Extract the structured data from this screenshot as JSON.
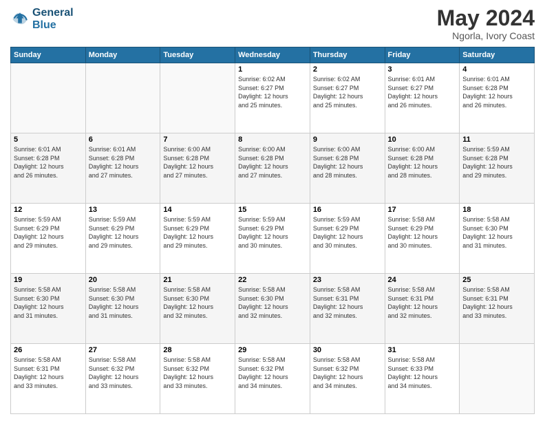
{
  "header": {
    "logo_line1": "General",
    "logo_line2": "Blue",
    "month_year": "May 2024",
    "location": "Ngorla, Ivory Coast"
  },
  "weekdays": [
    "Sunday",
    "Monday",
    "Tuesday",
    "Wednesday",
    "Thursday",
    "Friday",
    "Saturday"
  ],
  "weeks": [
    [
      {
        "day": "",
        "info": ""
      },
      {
        "day": "",
        "info": ""
      },
      {
        "day": "",
        "info": ""
      },
      {
        "day": "1",
        "info": "Sunrise: 6:02 AM\nSunset: 6:27 PM\nDaylight: 12 hours\nand 25 minutes."
      },
      {
        "day": "2",
        "info": "Sunrise: 6:02 AM\nSunset: 6:27 PM\nDaylight: 12 hours\nand 25 minutes."
      },
      {
        "day": "3",
        "info": "Sunrise: 6:01 AM\nSunset: 6:27 PM\nDaylight: 12 hours\nand 26 minutes."
      },
      {
        "day": "4",
        "info": "Sunrise: 6:01 AM\nSunset: 6:28 PM\nDaylight: 12 hours\nand 26 minutes."
      }
    ],
    [
      {
        "day": "5",
        "info": "Sunrise: 6:01 AM\nSunset: 6:28 PM\nDaylight: 12 hours\nand 26 minutes."
      },
      {
        "day": "6",
        "info": "Sunrise: 6:01 AM\nSunset: 6:28 PM\nDaylight: 12 hours\nand 27 minutes."
      },
      {
        "day": "7",
        "info": "Sunrise: 6:00 AM\nSunset: 6:28 PM\nDaylight: 12 hours\nand 27 minutes."
      },
      {
        "day": "8",
        "info": "Sunrise: 6:00 AM\nSunset: 6:28 PM\nDaylight: 12 hours\nand 27 minutes."
      },
      {
        "day": "9",
        "info": "Sunrise: 6:00 AM\nSunset: 6:28 PM\nDaylight: 12 hours\nand 28 minutes."
      },
      {
        "day": "10",
        "info": "Sunrise: 6:00 AM\nSunset: 6:28 PM\nDaylight: 12 hours\nand 28 minutes."
      },
      {
        "day": "11",
        "info": "Sunrise: 5:59 AM\nSunset: 6:28 PM\nDaylight: 12 hours\nand 29 minutes."
      }
    ],
    [
      {
        "day": "12",
        "info": "Sunrise: 5:59 AM\nSunset: 6:29 PM\nDaylight: 12 hours\nand 29 minutes."
      },
      {
        "day": "13",
        "info": "Sunrise: 5:59 AM\nSunset: 6:29 PM\nDaylight: 12 hours\nand 29 minutes."
      },
      {
        "day": "14",
        "info": "Sunrise: 5:59 AM\nSunset: 6:29 PM\nDaylight: 12 hours\nand 29 minutes."
      },
      {
        "day": "15",
        "info": "Sunrise: 5:59 AM\nSunset: 6:29 PM\nDaylight: 12 hours\nand 30 minutes."
      },
      {
        "day": "16",
        "info": "Sunrise: 5:59 AM\nSunset: 6:29 PM\nDaylight: 12 hours\nand 30 minutes."
      },
      {
        "day": "17",
        "info": "Sunrise: 5:58 AM\nSunset: 6:29 PM\nDaylight: 12 hours\nand 30 minutes."
      },
      {
        "day": "18",
        "info": "Sunrise: 5:58 AM\nSunset: 6:30 PM\nDaylight: 12 hours\nand 31 minutes."
      }
    ],
    [
      {
        "day": "19",
        "info": "Sunrise: 5:58 AM\nSunset: 6:30 PM\nDaylight: 12 hours\nand 31 minutes."
      },
      {
        "day": "20",
        "info": "Sunrise: 5:58 AM\nSunset: 6:30 PM\nDaylight: 12 hours\nand 31 minutes."
      },
      {
        "day": "21",
        "info": "Sunrise: 5:58 AM\nSunset: 6:30 PM\nDaylight: 12 hours\nand 32 minutes."
      },
      {
        "day": "22",
        "info": "Sunrise: 5:58 AM\nSunset: 6:30 PM\nDaylight: 12 hours\nand 32 minutes."
      },
      {
        "day": "23",
        "info": "Sunrise: 5:58 AM\nSunset: 6:31 PM\nDaylight: 12 hours\nand 32 minutes."
      },
      {
        "day": "24",
        "info": "Sunrise: 5:58 AM\nSunset: 6:31 PM\nDaylight: 12 hours\nand 32 minutes."
      },
      {
        "day": "25",
        "info": "Sunrise: 5:58 AM\nSunset: 6:31 PM\nDaylight: 12 hours\nand 33 minutes."
      }
    ],
    [
      {
        "day": "26",
        "info": "Sunrise: 5:58 AM\nSunset: 6:31 PM\nDaylight: 12 hours\nand 33 minutes."
      },
      {
        "day": "27",
        "info": "Sunrise: 5:58 AM\nSunset: 6:32 PM\nDaylight: 12 hours\nand 33 minutes."
      },
      {
        "day": "28",
        "info": "Sunrise: 5:58 AM\nSunset: 6:32 PM\nDaylight: 12 hours\nand 33 minutes."
      },
      {
        "day": "29",
        "info": "Sunrise: 5:58 AM\nSunset: 6:32 PM\nDaylight: 12 hours\nand 34 minutes."
      },
      {
        "day": "30",
        "info": "Sunrise: 5:58 AM\nSunset: 6:32 PM\nDaylight: 12 hours\nand 34 minutes."
      },
      {
        "day": "31",
        "info": "Sunrise: 5:58 AM\nSunset: 6:33 PM\nDaylight: 12 hours\nand 34 minutes."
      },
      {
        "day": "",
        "info": ""
      }
    ]
  ]
}
